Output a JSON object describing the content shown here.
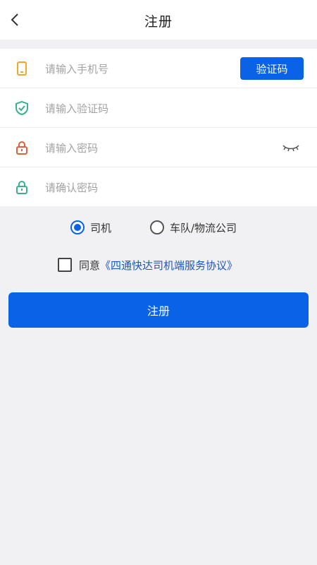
{
  "header": {
    "title": "注册"
  },
  "form": {
    "phone_placeholder": "请输入手机号",
    "code_button": "验证码",
    "code_placeholder": "请输入验证码",
    "password_placeholder": "请输入密码",
    "confirm_placeholder": "请确认密码"
  },
  "roles": {
    "options": [
      "司机",
      "车队/物流公司"
    ],
    "selected": "司机"
  },
  "agreement": {
    "prefix": "同意",
    "link": "《四通快达司机端服务协议》",
    "checked": false
  },
  "submit_label": "注册",
  "colors": {
    "primary": "#0a62e6",
    "phone_icon": "#f5a623",
    "code_icon": "#3bb08f",
    "password_icon": "#e0603c",
    "confirm_icon": "#3bb08f"
  }
}
